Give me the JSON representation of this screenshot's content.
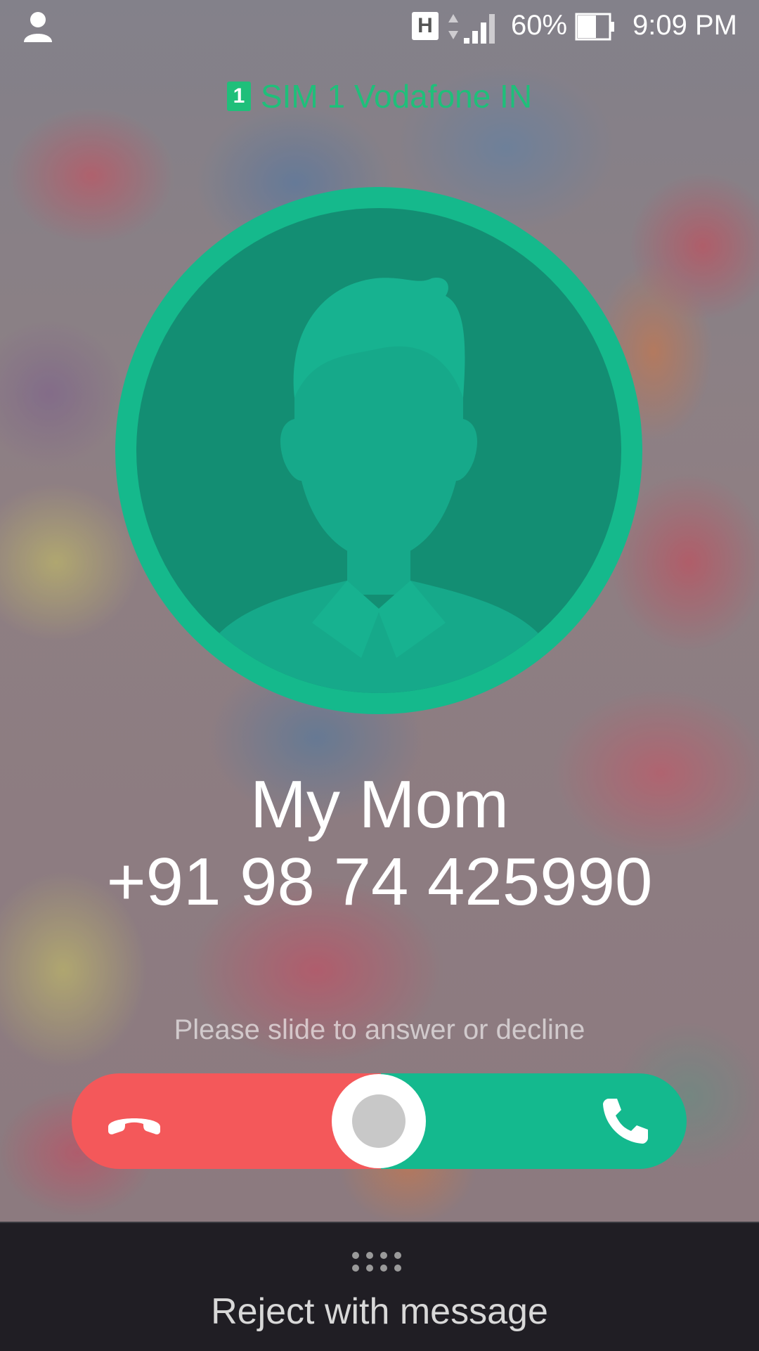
{
  "status_bar": {
    "network_type": "H",
    "battery_percent": "60%",
    "battery_level": 0.6,
    "time": "9:09 PM",
    "icons": [
      "account-icon",
      "network-arrows-icon",
      "signal-icon",
      "battery-icon"
    ]
  },
  "carrier": {
    "sim_number": "1",
    "label": "SIM 1  Vodafone IN",
    "color": "#1fbf7a"
  },
  "caller": {
    "name": "My Mom",
    "number": "+91 98 74 425990"
  },
  "slider": {
    "hint": "Please slide to answer or decline",
    "decline_color": "#f4585a",
    "answer_color": "#14b98e"
  },
  "bottom": {
    "reject_label": "Reject with message"
  }
}
